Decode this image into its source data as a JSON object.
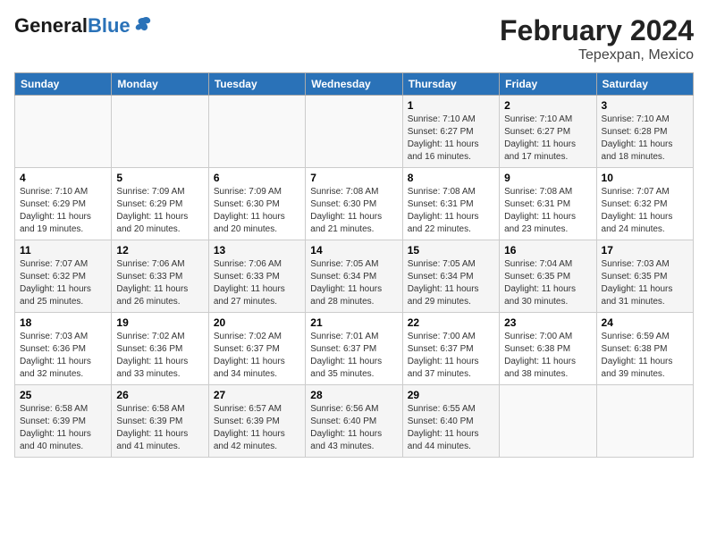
{
  "header": {
    "logo_general": "General",
    "logo_blue": "Blue",
    "title": "February 2024",
    "subtitle": "Tepexpan, Mexico"
  },
  "weekdays": [
    "Sunday",
    "Monday",
    "Tuesday",
    "Wednesday",
    "Thursday",
    "Friday",
    "Saturday"
  ],
  "weeks": [
    [
      {
        "day": "",
        "info": ""
      },
      {
        "day": "",
        "info": ""
      },
      {
        "day": "",
        "info": ""
      },
      {
        "day": "",
        "info": ""
      },
      {
        "day": "1",
        "info": "Sunrise: 7:10 AM\nSunset: 6:27 PM\nDaylight: 11 hours\nand 16 minutes."
      },
      {
        "day": "2",
        "info": "Sunrise: 7:10 AM\nSunset: 6:27 PM\nDaylight: 11 hours\nand 17 minutes."
      },
      {
        "day": "3",
        "info": "Sunrise: 7:10 AM\nSunset: 6:28 PM\nDaylight: 11 hours\nand 18 minutes."
      }
    ],
    [
      {
        "day": "4",
        "info": "Sunrise: 7:10 AM\nSunset: 6:29 PM\nDaylight: 11 hours\nand 19 minutes."
      },
      {
        "day": "5",
        "info": "Sunrise: 7:09 AM\nSunset: 6:29 PM\nDaylight: 11 hours\nand 20 minutes."
      },
      {
        "day": "6",
        "info": "Sunrise: 7:09 AM\nSunset: 6:30 PM\nDaylight: 11 hours\nand 20 minutes."
      },
      {
        "day": "7",
        "info": "Sunrise: 7:08 AM\nSunset: 6:30 PM\nDaylight: 11 hours\nand 21 minutes."
      },
      {
        "day": "8",
        "info": "Sunrise: 7:08 AM\nSunset: 6:31 PM\nDaylight: 11 hours\nand 22 minutes."
      },
      {
        "day": "9",
        "info": "Sunrise: 7:08 AM\nSunset: 6:31 PM\nDaylight: 11 hours\nand 23 minutes."
      },
      {
        "day": "10",
        "info": "Sunrise: 7:07 AM\nSunset: 6:32 PM\nDaylight: 11 hours\nand 24 minutes."
      }
    ],
    [
      {
        "day": "11",
        "info": "Sunrise: 7:07 AM\nSunset: 6:32 PM\nDaylight: 11 hours\nand 25 minutes."
      },
      {
        "day": "12",
        "info": "Sunrise: 7:06 AM\nSunset: 6:33 PM\nDaylight: 11 hours\nand 26 minutes."
      },
      {
        "day": "13",
        "info": "Sunrise: 7:06 AM\nSunset: 6:33 PM\nDaylight: 11 hours\nand 27 minutes."
      },
      {
        "day": "14",
        "info": "Sunrise: 7:05 AM\nSunset: 6:34 PM\nDaylight: 11 hours\nand 28 minutes."
      },
      {
        "day": "15",
        "info": "Sunrise: 7:05 AM\nSunset: 6:34 PM\nDaylight: 11 hours\nand 29 minutes."
      },
      {
        "day": "16",
        "info": "Sunrise: 7:04 AM\nSunset: 6:35 PM\nDaylight: 11 hours\nand 30 minutes."
      },
      {
        "day": "17",
        "info": "Sunrise: 7:03 AM\nSunset: 6:35 PM\nDaylight: 11 hours\nand 31 minutes."
      }
    ],
    [
      {
        "day": "18",
        "info": "Sunrise: 7:03 AM\nSunset: 6:36 PM\nDaylight: 11 hours\nand 32 minutes."
      },
      {
        "day": "19",
        "info": "Sunrise: 7:02 AM\nSunset: 6:36 PM\nDaylight: 11 hours\nand 33 minutes."
      },
      {
        "day": "20",
        "info": "Sunrise: 7:02 AM\nSunset: 6:37 PM\nDaylight: 11 hours\nand 34 minutes."
      },
      {
        "day": "21",
        "info": "Sunrise: 7:01 AM\nSunset: 6:37 PM\nDaylight: 11 hours\nand 35 minutes."
      },
      {
        "day": "22",
        "info": "Sunrise: 7:00 AM\nSunset: 6:37 PM\nDaylight: 11 hours\nand 37 minutes."
      },
      {
        "day": "23",
        "info": "Sunrise: 7:00 AM\nSunset: 6:38 PM\nDaylight: 11 hours\nand 38 minutes."
      },
      {
        "day": "24",
        "info": "Sunrise: 6:59 AM\nSunset: 6:38 PM\nDaylight: 11 hours\nand 39 minutes."
      }
    ],
    [
      {
        "day": "25",
        "info": "Sunrise: 6:58 AM\nSunset: 6:39 PM\nDaylight: 11 hours\nand 40 minutes."
      },
      {
        "day": "26",
        "info": "Sunrise: 6:58 AM\nSunset: 6:39 PM\nDaylight: 11 hours\nand 41 minutes."
      },
      {
        "day": "27",
        "info": "Sunrise: 6:57 AM\nSunset: 6:39 PM\nDaylight: 11 hours\nand 42 minutes."
      },
      {
        "day": "28",
        "info": "Sunrise: 6:56 AM\nSunset: 6:40 PM\nDaylight: 11 hours\nand 43 minutes."
      },
      {
        "day": "29",
        "info": "Sunrise: 6:55 AM\nSunset: 6:40 PM\nDaylight: 11 hours\nand 44 minutes."
      },
      {
        "day": "",
        "info": ""
      },
      {
        "day": "",
        "info": ""
      }
    ]
  ]
}
